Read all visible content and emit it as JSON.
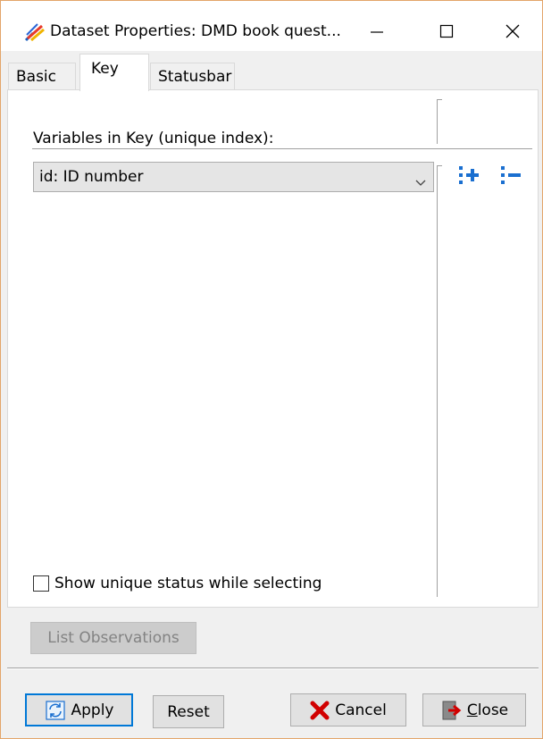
{
  "window": {
    "title": "Dataset Properties: DMD book quest...",
    "icon": "stata-app-icon",
    "controls": [
      "minimize-icon",
      "maximize-icon",
      "close-icon"
    ]
  },
  "tabs": [
    {
      "label": "Basic",
      "selected": false
    },
    {
      "label": "Key",
      "selected": true
    },
    {
      "label": "Statusbar",
      "selected": false
    }
  ],
  "key_panel": {
    "variables_label": "Variables in Key (unique index):",
    "key_variable": {
      "value": "id: ID number",
      "icon": "chevron-down-icon"
    },
    "add_icon": "add-key-variable-icon",
    "remove_icon": "remove-key-variable-icon",
    "show_unique_status": {
      "label": "Show unique status while selecting",
      "checked": false
    }
  },
  "list_observations_label": "List Observations",
  "footer": {
    "apply_label": "Apply",
    "reset_label": "Reset",
    "cancel_label": "Cancel",
    "close_label": "Close"
  },
  "colors": {
    "accent": "#0078d7",
    "icon_blue": "#1a6fd0",
    "cancel_red": "#d10000",
    "window_border": "#e3a56a"
  }
}
